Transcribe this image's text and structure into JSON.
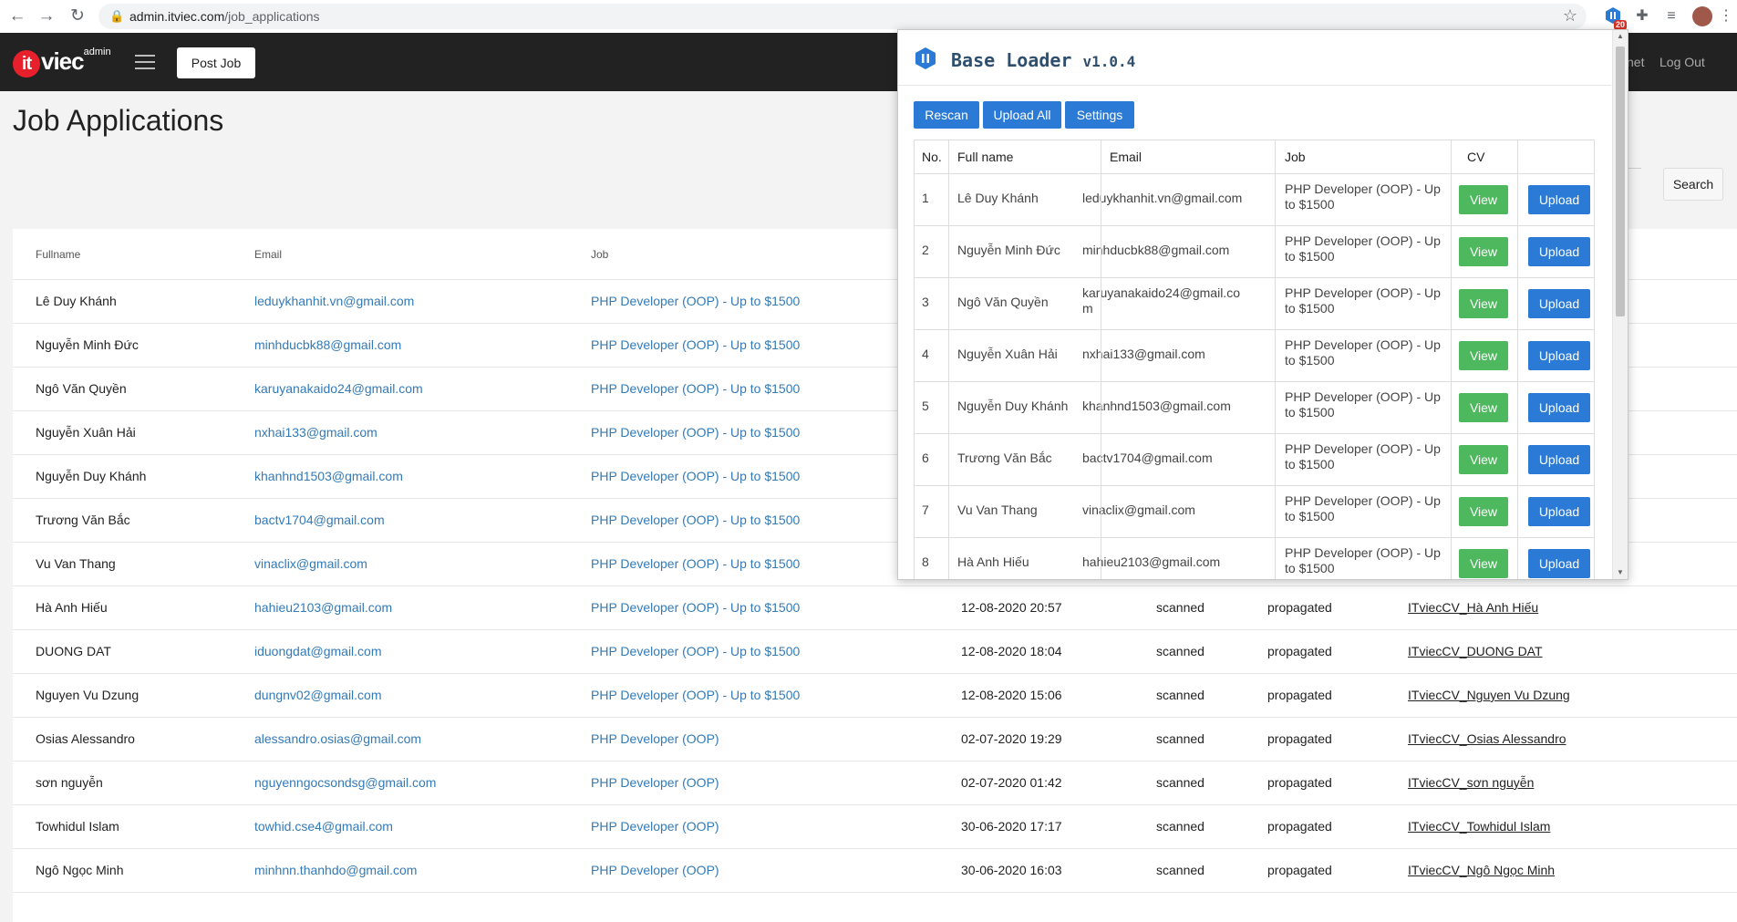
{
  "browser": {
    "url_host": "admin.itviec.com",
    "url_path": "/job_applications",
    "ext_badge": "20"
  },
  "header": {
    "logo_it": "it",
    "logo_viec": "viec",
    "logo_sup": "admin",
    "post_job": "Post Job",
    "link_partial": "net",
    "logout": "Log Out"
  },
  "page": {
    "title": "Job Applications",
    "search_button": "Search"
  },
  "main_table": {
    "headers": [
      "Fullname",
      "Email",
      "Job"
    ],
    "rows": [
      {
        "name": "Lê Duy Khánh",
        "email": "leduykhanhit.vn@gmail.com",
        "job": "PHP Developer (OOP) - Up to $1500",
        "date": "",
        "scanned": "",
        "propagated": "",
        "cv": ""
      },
      {
        "name": "Nguyễn Minh Đức",
        "email": "minhducbk88@gmail.com",
        "job": "PHP Developer (OOP) - Up to $1500",
        "date": "",
        "scanned": "",
        "propagated": "",
        "cv": ""
      },
      {
        "name": "Ngô Văn Quyền",
        "email": "karuyanakaido24@gmail.com",
        "job": "PHP Developer (OOP) - Up to $1500",
        "date": "",
        "scanned": "",
        "propagated": "",
        "cv": ""
      },
      {
        "name": "Nguyễn Xuân Hải",
        "email": "nxhai133@gmail.com",
        "job": "PHP Developer (OOP) - Up to $1500",
        "date": "",
        "scanned": "",
        "propagated": "",
        "cv": ""
      },
      {
        "name": "Nguyễn Duy Khánh",
        "email": "khanhnd1503@gmail.com",
        "job": "PHP Developer (OOP) - Up to $1500",
        "date": "",
        "scanned": "",
        "propagated": "",
        "cv": ""
      },
      {
        "name": "Trương Văn Bắc",
        "email": "bactv1704@gmail.com",
        "job": "PHP Developer (OOP) - Up to $1500",
        "date": "",
        "scanned": "",
        "propagated": "",
        "cv": ""
      },
      {
        "name": "Vu Van Thang",
        "email": "vinaclix@gmail.com",
        "job": "PHP Developer (OOP) - Up to $1500",
        "date": "",
        "scanned": "",
        "propagated": "",
        "cv": ""
      },
      {
        "name": "Hà Anh Hiếu",
        "email": "hahieu2103@gmail.com",
        "job": "PHP Developer (OOP) - Up to $1500",
        "date": "12-08-2020 20:57",
        "scanned": "scanned",
        "propagated": "propagated",
        "cv": "ITviecCV_Hà Anh Hiếu"
      },
      {
        "name": "DUONG DAT",
        "email": "iduongdat@gmail.com",
        "job": "PHP Developer (OOP) - Up to $1500",
        "date": "12-08-2020 18:04",
        "scanned": "scanned",
        "propagated": "propagated",
        "cv": "ITviecCV_DUONG DAT"
      },
      {
        "name": "Nguyen Vu Dzung",
        "email": "dungnv02@gmail.com",
        "job": "PHP Developer (OOP) - Up to $1500",
        "date": "12-08-2020 15:06",
        "scanned": "scanned",
        "propagated": "propagated",
        "cv": "ITviecCV_Nguyen Vu Dzung"
      },
      {
        "name": "Osias Alessandro",
        "email": "alessandro.osias@gmail.com",
        "job": "PHP Developer (OOP)",
        "date": "02-07-2020 19:29",
        "scanned": "scanned",
        "propagated": "propagated",
        "cv": "ITviecCV_Osias Alessandro"
      },
      {
        "name": "sơn nguyễn",
        "email": "nguyenngocsondsg@gmail.com",
        "job": "PHP Developer (OOP)",
        "date": "02-07-2020 01:42",
        "scanned": "scanned",
        "propagated": "propagated",
        "cv": "ITviecCV_sơn nguyễn"
      },
      {
        "name": "Towhidul Islam",
        "email": "towhid.cse4@gmail.com",
        "job": "PHP Developer (OOP)",
        "date": "30-06-2020 17:17",
        "scanned": "scanned",
        "propagated": "propagated",
        "cv": "ITviecCV_Towhidul Islam"
      },
      {
        "name": "Ngô Ngọc Minh",
        "email": "minhnn.thanhdo@gmail.com",
        "job": "PHP Developer (OOP)",
        "date": "30-06-2020 16:03",
        "scanned": "scanned",
        "propagated": "propagated",
        "cv": "ITviecCV_Ngô Ngọc Minh"
      }
    ]
  },
  "popup": {
    "title": "Base Loader",
    "version": "v1.0.4",
    "buttons": {
      "rescan": "Rescan",
      "upload_all": "Upload All",
      "settings": "Settings"
    },
    "headers": {
      "no": "No.",
      "fullname": "Full name",
      "email": "Email",
      "job": "Job",
      "cv": "CV"
    },
    "view_label": "View",
    "upload_label": "Upload",
    "rows": [
      {
        "no": "1",
        "name": "Lê Duy Khánh",
        "email": "leduykhanhit.vn@gmail.com",
        "job": "PHP Developer (OOP) - Up to $1500"
      },
      {
        "no": "2",
        "name": "Nguyễn Minh Đức",
        "email": "minhducbk88@gmail.com",
        "job": "PHP Developer (OOP) - Up to $1500"
      },
      {
        "no": "3",
        "name": "Ngô Văn Quyền",
        "email": "karuyanakaido24@gmail.com",
        "job": "PHP Developer (OOP) - Up to $1500"
      },
      {
        "no": "4",
        "name": "Nguyễn Xuân Hải",
        "email": "nxhai133@gmail.com",
        "job": "PHP Developer (OOP) - Up to $1500"
      },
      {
        "no": "5",
        "name": "Nguyễn Duy Khánh",
        "email": "khanhnd1503@gmail.com",
        "job": "PHP Developer (OOP) - Up to $1500"
      },
      {
        "no": "6",
        "name": "Trương Văn Bắc",
        "email": "bactv1704@gmail.com",
        "job": "PHP Developer (OOP) - Up to $1500"
      },
      {
        "no": "7",
        "name": "Vu Van Thang",
        "email": "vinaclix@gmail.com",
        "job": "PHP Developer (OOP) - Up to $1500"
      },
      {
        "no": "8",
        "name": "Hà Anh Hiếu",
        "email": "hahieu2103@gmail.com",
        "job": "PHP Developer (OOP) - Up to $1500"
      }
    ]
  }
}
